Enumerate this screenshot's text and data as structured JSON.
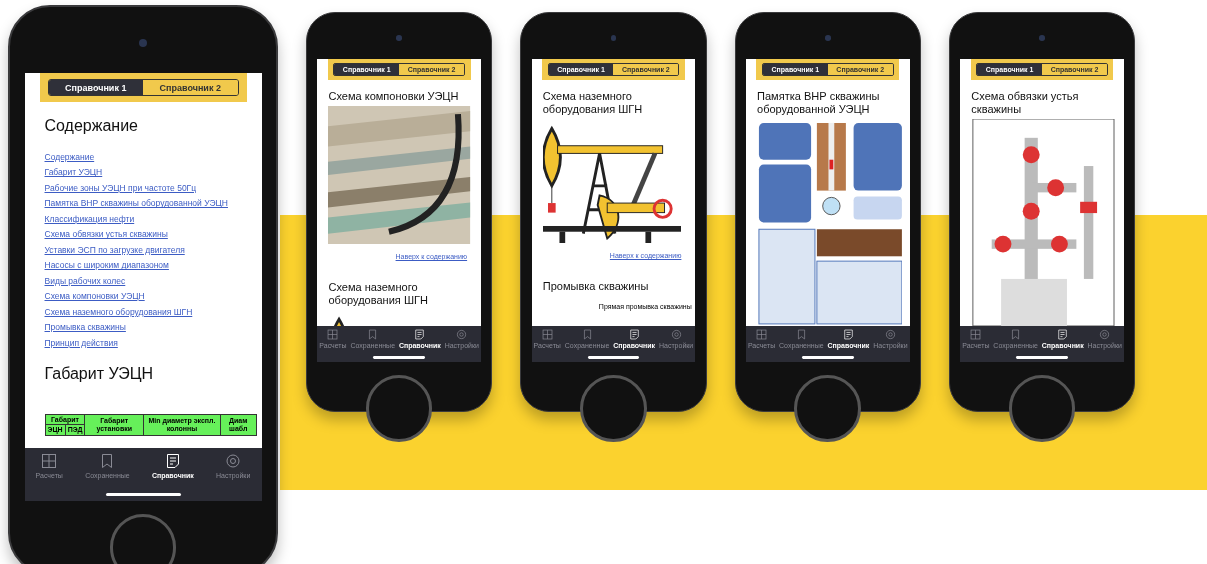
{
  "phones": [
    {
      "tabs": [
        {
          "label": "Справочник 1",
          "selected": true
        },
        {
          "label": "Справочник 2",
          "selected": false
        }
      ],
      "content": [
        {
          "kind": "heading",
          "text": "Содержание"
        },
        {
          "kind": "links",
          "items": [
            "Содержание",
            "Габарит УЭЦН",
            "Рабочие зоны УЭЦН при частоте 50Гц",
            "Памятка ВНР скважины оборудованной УЭЦН",
            "Классификация нефти",
            "Схема обвязки устья скважины",
            "Уставки ЭСП по загрузке двигателя",
            "Насосы с широким диапазоном",
            "Виды рабочих колес",
            "Схема компоновки УЭЦН",
            "Схема наземного оборудования ШГН",
            "Промывка скважины",
            "Принцип действия"
          ]
        },
        {
          "kind": "heading",
          "text": "Габарит УЭЦН"
        },
        {
          "kind": "table",
          "columns": [
            {
              "label": "Габарит",
              "children": [
                "ЭЦН",
                "ПЭД"
              ]
            },
            {
              "label": "Габарит установки"
            },
            {
              "label": "Min диаметр экспл. колонны"
            },
            {
              "label": "Диам шабл"
            }
          ]
        }
      ],
      "nav": [
        {
          "label": "Расчеты",
          "selected": false
        },
        {
          "label": "Сохраненные",
          "selected": false
        },
        {
          "label": "Справочник",
          "selected": true
        },
        {
          "label": "Настройки",
          "selected": false
        }
      ]
    },
    {
      "tabs": [
        {
          "label": "Справочник 1",
          "selected": true
        },
        {
          "label": "Справочник 2",
          "selected": false
        }
      ],
      "content": [
        {
          "kind": "heading",
          "text": "Схема компоновки УЭЦН"
        },
        {
          "kind": "photo"
        },
        {
          "kind": "backlink",
          "text": "Наверх к содержанию"
        },
        {
          "kind": "heading",
          "text": "Схема наземного оборудования ШГН"
        },
        {
          "kind": "machine"
        }
      ],
      "nav": [
        {
          "label": "Расчеты",
          "selected": false
        },
        {
          "label": "Сохраненные",
          "selected": false
        },
        {
          "label": "Справочник",
          "selected": true
        },
        {
          "label": "Настройки",
          "selected": false
        }
      ]
    },
    {
      "tabs": [
        {
          "label": "Справочник 1",
          "selected": true
        },
        {
          "label": "Справочник 2",
          "selected": false
        }
      ],
      "content": [
        {
          "kind": "heading",
          "text": "Схема наземного оборудования ШГН"
        },
        {
          "kind": "machine"
        },
        {
          "kind": "backlink",
          "text": "Наверх к содержанию"
        },
        {
          "kind": "heading",
          "text": "Промывка скважины"
        },
        {
          "kind": "caption",
          "text": "Прямая промывка скважины"
        }
      ],
      "nav": [
        {
          "label": "Расчеты",
          "selected": false
        },
        {
          "label": "Сохраненные",
          "selected": false
        },
        {
          "label": "Справочник",
          "selected": true
        },
        {
          "label": "Настройки",
          "selected": false
        }
      ]
    },
    {
      "tabs": [
        {
          "label": "Справочник 1",
          "selected": true
        },
        {
          "label": "Справочник 2",
          "selected": false
        }
      ],
      "content": [
        {
          "kind": "heading",
          "text": "Памятка ВНР скважины оборудованной УЭЦН"
        },
        {
          "kind": "infographic"
        }
      ],
      "nav": [
        {
          "label": "Расчеты",
          "selected": false
        },
        {
          "label": "Сохраненные",
          "selected": false
        },
        {
          "label": "Справочник",
          "selected": true
        },
        {
          "label": "Настройки",
          "selected": false
        }
      ]
    },
    {
      "tabs": [
        {
          "label": "Справочник 1",
          "selected": true
        },
        {
          "label": "Справочник 2",
          "selected": false
        }
      ],
      "content": [
        {
          "kind": "heading",
          "text": "Схема обвязки устья скважины"
        },
        {
          "kind": "schematic"
        }
      ],
      "nav": [
        {
          "label": "Расчеты",
          "selected": false
        },
        {
          "label": "Сохраненные",
          "selected": false
        },
        {
          "label": "Справочник",
          "selected": true
        },
        {
          "label": "Настройки",
          "selected": false
        }
      ]
    }
  ]
}
